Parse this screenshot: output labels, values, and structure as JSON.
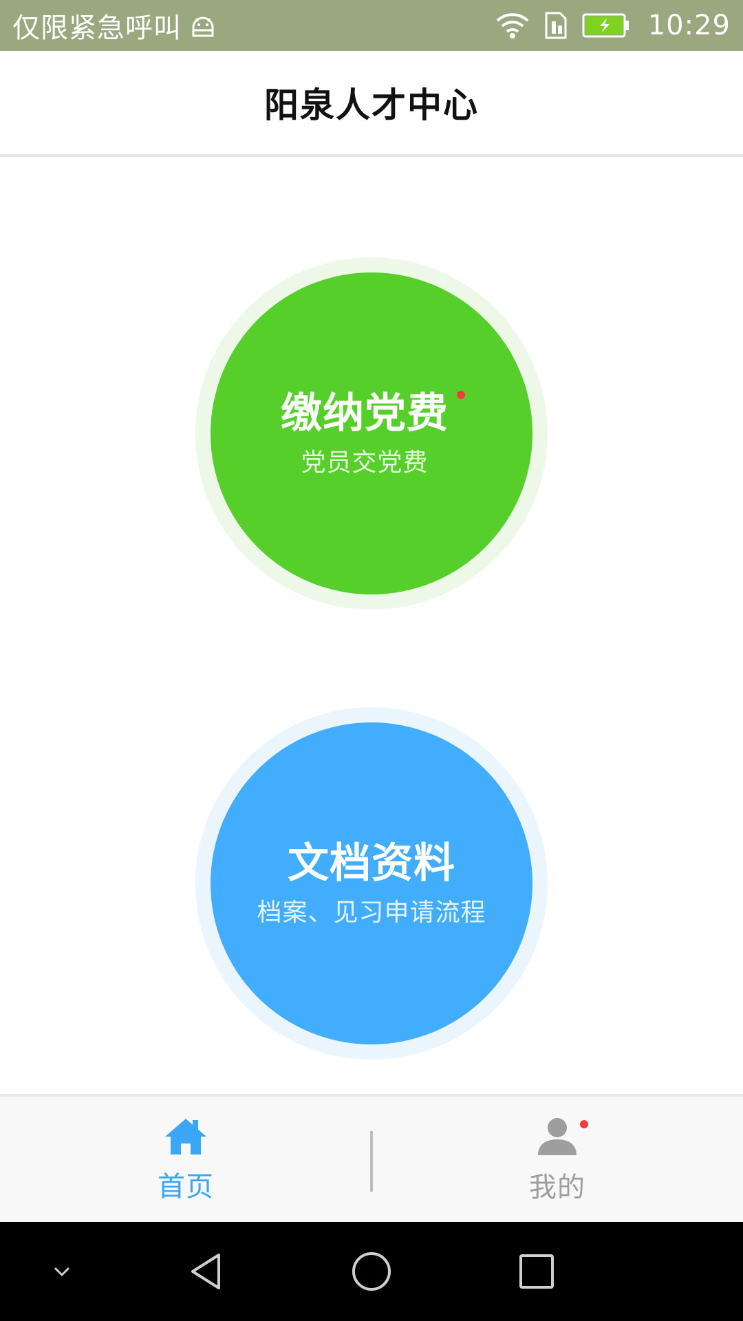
{
  "status_bar": {
    "carrier_text": "仅限紧急呼叫",
    "time": "10:29",
    "icons": [
      "android-icon",
      "wifi-icon",
      "sim-icon",
      "battery-charging-icon"
    ],
    "background_color": "#9aa77f",
    "battery_color": "#7ed321"
  },
  "header": {
    "title": "阳泉人才中心"
  },
  "main": {
    "cards": [
      {
        "title": "缴纳党费",
        "subtitle": "党员交党费",
        "color": "#57cf2a",
        "halo_color": "#eef8e8",
        "has_notification_dot": true
      },
      {
        "title": "文档资料",
        "subtitle": "档案、见习申请流程",
        "color": "#42acfd",
        "halo_color": "#eaf5fe",
        "has_notification_dot": false
      }
    ]
  },
  "tab_bar": {
    "tabs": [
      {
        "label": "首页",
        "icon": "home-icon",
        "active": true
      },
      {
        "label": "我的",
        "icon": "user-icon",
        "active": false,
        "has_notification_dot": true
      }
    ],
    "active_color": "#3aa6f5",
    "inactive_color": "#9e9e9e"
  },
  "nav_bar": {
    "buttons": [
      "collapse-icon",
      "back-icon",
      "home-circle-icon",
      "recents-icon"
    ]
  }
}
